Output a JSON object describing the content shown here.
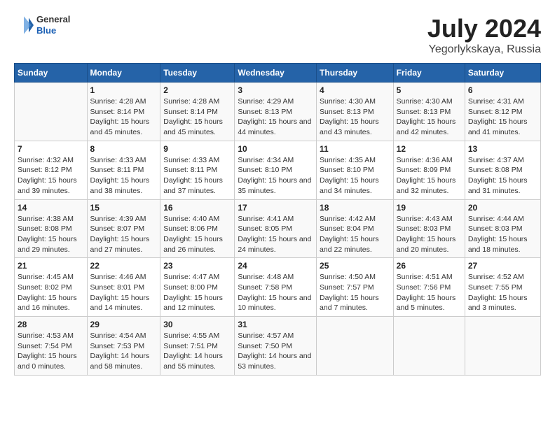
{
  "header": {
    "logo": {
      "general": "General",
      "blue": "Blue"
    },
    "title": "July 2024",
    "subtitle": "Yegorlykskaya, Russia"
  },
  "days_of_week": [
    "Sunday",
    "Monday",
    "Tuesday",
    "Wednesday",
    "Thursday",
    "Friday",
    "Saturday"
  ],
  "weeks": [
    [
      {
        "day": "",
        "empty": true
      },
      {
        "day": "1",
        "sunrise": "Sunrise: 4:28 AM",
        "sunset": "Sunset: 8:14 PM",
        "daylight": "Daylight: 15 hours and 45 minutes."
      },
      {
        "day": "2",
        "sunrise": "Sunrise: 4:28 AM",
        "sunset": "Sunset: 8:14 PM",
        "daylight": "Daylight: 15 hours and 45 minutes."
      },
      {
        "day": "3",
        "sunrise": "Sunrise: 4:29 AM",
        "sunset": "Sunset: 8:13 PM",
        "daylight": "Daylight: 15 hours and 44 minutes."
      },
      {
        "day": "4",
        "sunrise": "Sunrise: 4:30 AM",
        "sunset": "Sunset: 8:13 PM",
        "daylight": "Daylight: 15 hours and 43 minutes."
      },
      {
        "day": "5",
        "sunrise": "Sunrise: 4:30 AM",
        "sunset": "Sunset: 8:13 PM",
        "daylight": "Daylight: 15 hours and 42 minutes."
      },
      {
        "day": "6",
        "sunrise": "Sunrise: 4:31 AM",
        "sunset": "Sunset: 8:12 PM",
        "daylight": "Daylight: 15 hours and 41 minutes."
      }
    ],
    [
      {
        "day": "7",
        "sunrise": "Sunrise: 4:32 AM",
        "sunset": "Sunset: 8:12 PM",
        "daylight": "Daylight: 15 hours and 39 minutes."
      },
      {
        "day": "8",
        "sunrise": "Sunrise: 4:33 AM",
        "sunset": "Sunset: 8:11 PM",
        "daylight": "Daylight: 15 hours and 38 minutes."
      },
      {
        "day": "9",
        "sunrise": "Sunrise: 4:33 AM",
        "sunset": "Sunset: 8:11 PM",
        "daylight": "Daylight: 15 hours and 37 minutes."
      },
      {
        "day": "10",
        "sunrise": "Sunrise: 4:34 AM",
        "sunset": "Sunset: 8:10 PM",
        "daylight": "Daylight: 15 hours and 35 minutes."
      },
      {
        "day": "11",
        "sunrise": "Sunrise: 4:35 AM",
        "sunset": "Sunset: 8:10 PM",
        "daylight": "Daylight: 15 hours and 34 minutes."
      },
      {
        "day": "12",
        "sunrise": "Sunrise: 4:36 AM",
        "sunset": "Sunset: 8:09 PM",
        "daylight": "Daylight: 15 hours and 32 minutes."
      },
      {
        "day": "13",
        "sunrise": "Sunrise: 4:37 AM",
        "sunset": "Sunset: 8:08 PM",
        "daylight": "Daylight: 15 hours and 31 minutes."
      }
    ],
    [
      {
        "day": "14",
        "sunrise": "Sunrise: 4:38 AM",
        "sunset": "Sunset: 8:08 PM",
        "daylight": "Daylight: 15 hours and 29 minutes."
      },
      {
        "day": "15",
        "sunrise": "Sunrise: 4:39 AM",
        "sunset": "Sunset: 8:07 PM",
        "daylight": "Daylight: 15 hours and 27 minutes."
      },
      {
        "day": "16",
        "sunrise": "Sunrise: 4:40 AM",
        "sunset": "Sunset: 8:06 PM",
        "daylight": "Daylight: 15 hours and 26 minutes."
      },
      {
        "day": "17",
        "sunrise": "Sunrise: 4:41 AM",
        "sunset": "Sunset: 8:05 PM",
        "daylight": "Daylight: 15 hours and 24 minutes."
      },
      {
        "day": "18",
        "sunrise": "Sunrise: 4:42 AM",
        "sunset": "Sunset: 8:04 PM",
        "daylight": "Daylight: 15 hours and 22 minutes."
      },
      {
        "day": "19",
        "sunrise": "Sunrise: 4:43 AM",
        "sunset": "Sunset: 8:03 PM",
        "daylight": "Daylight: 15 hours and 20 minutes."
      },
      {
        "day": "20",
        "sunrise": "Sunrise: 4:44 AM",
        "sunset": "Sunset: 8:03 PM",
        "daylight": "Daylight: 15 hours and 18 minutes."
      }
    ],
    [
      {
        "day": "21",
        "sunrise": "Sunrise: 4:45 AM",
        "sunset": "Sunset: 8:02 PM",
        "daylight": "Daylight: 15 hours and 16 minutes."
      },
      {
        "day": "22",
        "sunrise": "Sunrise: 4:46 AM",
        "sunset": "Sunset: 8:01 PM",
        "daylight": "Daylight: 15 hours and 14 minutes."
      },
      {
        "day": "23",
        "sunrise": "Sunrise: 4:47 AM",
        "sunset": "Sunset: 8:00 PM",
        "daylight": "Daylight: 15 hours and 12 minutes."
      },
      {
        "day": "24",
        "sunrise": "Sunrise: 4:48 AM",
        "sunset": "Sunset: 7:58 PM",
        "daylight": "Daylight: 15 hours and 10 minutes."
      },
      {
        "day": "25",
        "sunrise": "Sunrise: 4:50 AM",
        "sunset": "Sunset: 7:57 PM",
        "daylight": "Daylight: 15 hours and 7 minutes."
      },
      {
        "day": "26",
        "sunrise": "Sunrise: 4:51 AM",
        "sunset": "Sunset: 7:56 PM",
        "daylight": "Daylight: 15 hours and 5 minutes."
      },
      {
        "day": "27",
        "sunrise": "Sunrise: 4:52 AM",
        "sunset": "Sunset: 7:55 PM",
        "daylight": "Daylight: 15 hours and 3 minutes."
      }
    ],
    [
      {
        "day": "28",
        "sunrise": "Sunrise: 4:53 AM",
        "sunset": "Sunset: 7:54 PM",
        "daylight": "Daylight: 15 hours and 0 minutes."
      },
      {
        "day": "29",
        "sunrise": "Sunrise: 4:54 AM",
        "sunset": "Sunset: 7:53 PM",
        "daylight": "Daylight: 14 hours and 58 minutes."
      },
      {
        "day": "30",
        "sunrise": "Sunrise: 4:55 AM",
        "sunset": "Sunset: 7:51 PM",
        "daylight": "Daylight: 14 hours and 55 minutes."
      },
      {
        "day": "31",
        "sunrise": "Sunrise: 4:57 AM",
        "sunset": "Sunset: 7:50 PM",
        "daylight": "Daylight: 14 hours and 53 minutes."
      },
      {
        "day": "",
        "empty": true
      },
      {
        "day": "",
        "empty": true
      },
      {
        "day": "",
        "empty": true
      }
    ]
  ]
}
